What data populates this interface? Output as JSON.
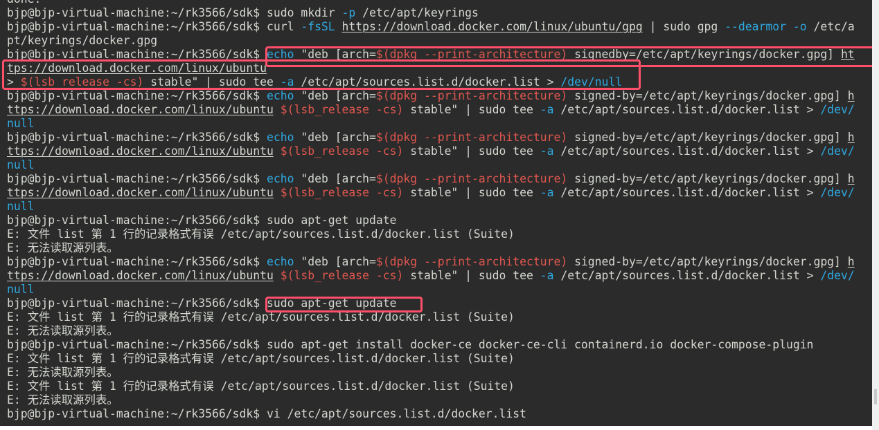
{
  "colors": {
    "background": "#2b2b2b",
    "text": "#d3d7cf",
    "builtin": "#2fa8e0",
    "substitution": "#e0574f",
    "highlight_box": "#ff4f6b"
  },
  "lines": [
    [
      {
        "t": "done."
      }
    ],
    [
      {
        "t": "bjp@bjp-virtual-machine:~/rk3566/sdk$ sudo mkdir "
      },
      {
        "t": "-p",
        "c": "blue"
      },
      {
        "t": " /etc/apt/keyrings"
      }
    ],
    [
      {
        "t": "bjp@bjp-virtual-machine:~/rk3566/sdk$ curl "
      },
      {
        "t": "-fsSL",
        "c": "blue"
      },
      {
        "t": " "
      },
      {
        "t": "https://download.docker.com/linux/ubuntu/gpg",
        "u": true
      },
      {
        "t": " | sudo gpg "
      },
      {
        "t": "--dearmor",
        "c": "blue"
      },
      {
        "t": " "
      },
      {
        "t": "-o",
        "c": "blue"
      },
      {
        "t": " /etc/a"
      }
    ],
    [
      {
        "t": "pt/keyrings/docker.gpg"
      }
    ],
    [
      {
        "t": "bjp@bjp-virtual-machine:~/rk3566/sdk$ "
      },
      {
        "t": "echo",
        "c": "blue"
      },
      {
        "t": " \"deb [arch="
      },
      {
        "t": "$(dpkg --print-architecture)",
        "c": "red"
      },
      {
        "t": " signedby=/etc/apt/keyrings/docker.gpg] "
      },
      {
        "t": "ht",
        "u": true
      }
    ],
    [
      {
        "t": "tps://download.docker.com/linux/ubuntu",
        "u": true
      }
    ],
    [
      {
        "t": "> "
      },
      {
        "t": "$(lsb_release -cs)",
        "c": "red"
      },
      {
        "t": " stable\" | sudo tee "
      },
      {
        "t": "-a",
        "c": "blue"
      },
      {
        "t": " /etc/apt/sources.list.d/docker.list > "
      },
      {
        "t": "/dev/null",
        "c": "blue"
      }
    ],
    [
      {
        "t": "bjp@bjp-virtual-machine:~/rk3566/sdk$ "
      },
      {
        "t": "echo",
        "c": "blue"
      },
      {
        "t": " \"deb [arch="
      },
      {
        "t": "$(dpkg --print-architecture)",
        "c": "red"
      },
      {
        "t": " signed-by=/etc/apt/keyrings/docker.gpg] "
      },
      {
        "t": "h",
        "u": true
      }
    ],
    [
      {
        "t": "ttps://download.docker.com/linux/ubuntu",
        "u": true
      },
      {
        "t": " "
      },
      {
        "t": "$(lsb_release -cs)",
        "c": "red"
      },
      {
        "t": " stable\" | sudo tee "
      },
      {
        "t": "-a",
        "c": "blue"
      },
      {
        "t": " /etc/apt/sources.list.d/docker.list > "
      },
      {
        "t": "/dev/",
        "c": "blue"
      }
    ],
    [
      {
        "t": "null",
        "c": "blue"
      }
    ],
    [
      {
        "t": "bjp@bjp-virtual-machine:~/rk3566/sdk$ "
      },
      {
        "t": "echo",
        "c": "blue"
      },
      {
        "t": " \"deb [arch="
      },
      {
        "t": "$(dpkg --print-architecture)",
        "c": "red"
      },
      {
        "t": " signed-by=/etc/apt/keyrings/docker.gpg] "
      },
      {
        "t": "h",
        "u": true
      }
    ],
    [
      {
        "t": "ttps://download.docker.com/linux/ubuntu",
        "u": true
      },
      {
        "t": " "
      },
      {
        "t": "$(lsb_release -cs)",
        "c": "red"
      },
      {
        "t": " stable\" | sudo tee "
      },
      {
        "t": "-a",
        "c": "blue"
      },
      {
        "t": " /etc/apt/sources.list.d/docker.list > "
      },
      {
        "t": "/dev/",
        "c": "blue"
      }
    ],
    [
      {
        "t": "null",
        "c": "blue"
      }
    ],
    [
      {
        "t": "bjp@bjp-virtual-machine:~/rk3566/sdk$ "
      },
      {
        "t": "echo",
        "c": "blue"
      },
      {
        "t": " \"deb [arch="
      },
      {
        "t": "$(dpkg --print-architecture)",
        "c": "red"
      },
      {
        "t": " signed-by=/etc/apt/keyrings/docker.gpg] "
      },
      {
        "t": "h",
        "u": true
      }
    ],
    [
      {
        "t": "ttps://download.docker.com/linux/ubuntu",
        "u": true
      },
      {
        "t": " "
      },
      {
        "t": "$(lsb_release -cs)",
        "c": "red"
      },
      {
        "t": " stable\" | sudo tee "
      },
      {
        "t": "-a",
        "c": "blue"
      },
      {
        "t": " /etc/apt/sources.list.d/docker.list > "
      },
      {
        "t": "/dev/",
        "c": "blue"
      }
    ],
    [
      {
        "t": "null",
        "c": "blue"
      }
    ],
    [
      {
        "t": "bjp@bjp-virtual-machine:~/rk3566/sdk$ sudo apt-get update"
      }
    ],
    [
      {
        "t": "E: 文件 list 第 1 行的记录格式有误 /etc/apt/sources.list.d/docker.list (Suite)"
      }
    ],
    [
      {
        "t": "E: 无法读取源列表。"
      }
    ],
    [
      {
        "t": "bjp@bjp-virtual-machine:~/rk3566/sdk$ "
      },
      {
        "t": "echo",
        "c": "blue"
      },
      {
        "t": " \"deb [arch="
      },
      {
        "t": "$(dpkg --print-architecture)",
        "c": "red"
      },
      {
        "t": " signed-by=/etc/apt/keyrings/docker.gpg] "
      },
      {
        "t": "h",
        "u": true
      }
    ],
    [
      {
        "t": "ttps://download.docker.com/linux/ubuntu",
        "u": true
      },
      {
        "t": " "
      },
      {
        "t": "$(lsb_release -cs)",
        "c": "red"
      },
      {
        "t": " stable\" | sudo tee "
      },
      {
        "t": "-a",
        "c": "blue"
      },
      {
        "t": " /etc/apt/sources.list.d/docker.list > "
      },
      {
        "t": "/dev/",
        "c": "blue"
      }
    ],
    [
      {
        "t": "null",
        "c": "blue"
      }
    ],
    [
      {
        "t": "bjp@bjp-virtual-machine:~/rk3566/sdk$ sudo apt-get update"
      }
    ],
    [
      {
        "t": "E: 文件 list 第 1 行的记录格式有误 /etc/apt/sources.list.d/docker.list (Suite)"
      }
    ],
    [
      {
        "t": "E: 无法读取源列表。"
      }
    ],
    [
      {
        "t": "bjp@bjp-virtual-machine:~/rk3566/sdk$ sudo apt-get install docker-ce docker-ce-cli containerd.io docker-compose-plugin"
      }
    ],
    [
      {
        "t": "E: 文件 list 第 1 行的记录格式有误 /etc/apt/sources.list.d/docker.list (Suite)"
      }
    ],
    [
      {
        "t": "E: 无法读取源列表。"
      }
    ],
    [
      {
        "t": "E: 文件 list 第 1 行的记录格式有误 /etc/apt/sources.list.d/docker.list (Suite)"
      }
    ],
    [
      {
        "t": "E: 无法读取源列表。"
      }
    ],
    [
      {
        "t": "bjp@bjp-virtual-machine:~/rk3566/sdk$ vi /etc/apt/sources.list.d/docker.list"
      }
    ]
  ]
}
